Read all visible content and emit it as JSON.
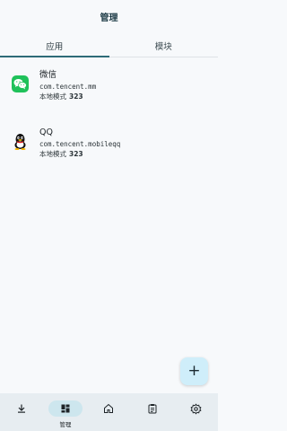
{
  "header": {
    "title": "管理"
  },
  "tabs": [
    {
      "label": "应用",
      "active": true
    },
    {
      "label": "模块",
      "active": false
    }
  ],
  "apps": [
    {
      "name": "微信",
      "package": "com.tencent.mm",
      "mode_label": "本地模式",
      "mode_value": "323",
      "icon": "wechat-icon"
    },
    {
      "name": "QQ",
      "package": "com.tencent.mobileqq",
      "mode_label": "本地模式",
      "mode_value": "323",
      "icon": "qq-icon"
    }
  ],
  "fab": {
    "label": "+",
    "icon": "add-icon"
  },
  "bottom_nav": [
    {
      "icon": "download-icon",
      "label": "",
      "active": false
    },
    {
      "icon": "dashboard-icon",
      "label": "管理",
      "active": true
    },
    {
      "icon": "home-icon",
      "label": "",
      "active": false
    },
    {
      "icon": "clipboard-icon",
      "label": "",
      "active": false
    },
    {
      "icon": "settings-icon",
      "label": "",
      "active": false
    }
  ],
  "colors": {
    "accent": "#2e6b78",
    "fab_bg": "#cfeefa",
    "nav_bg": "#e7edf1",
    "wechat_green": "#1fc15a"
  }
}
